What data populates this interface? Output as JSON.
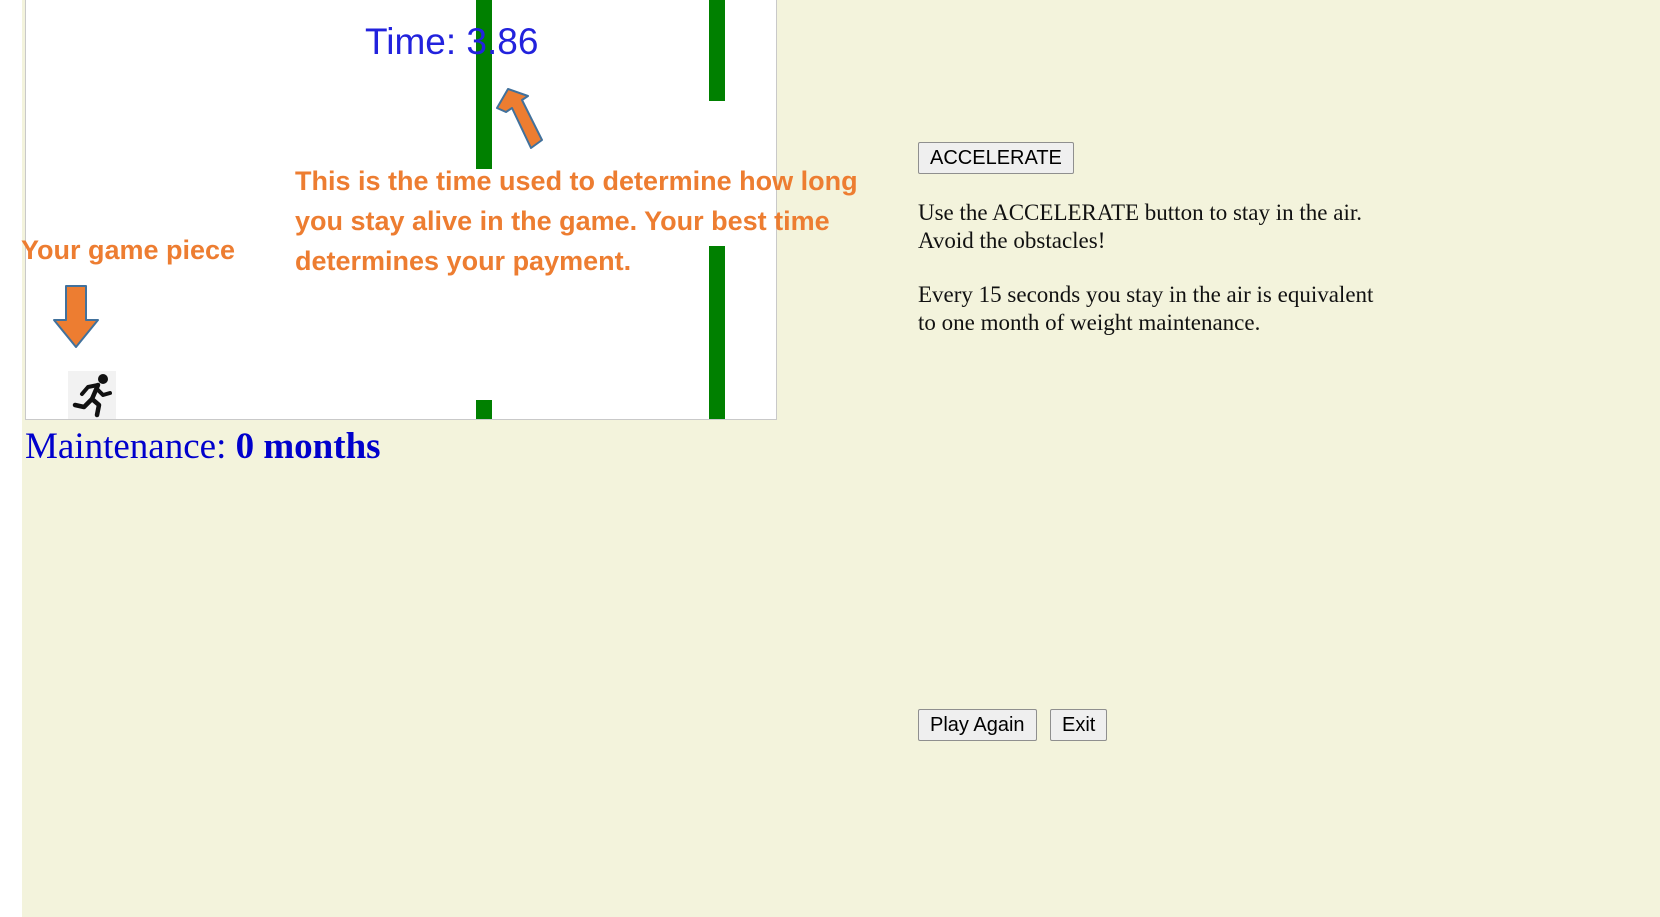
{
  "game": {
    "timer_label": "Time: ",
    "timer_value": "3.86",
    "pipe_color": "#008000",
    "game_piece_icon": "running-person-icon"
  },
  "status": {
    "maintenance_label": "Maintenance: ",
    "maintenance_value": "0 months"
  },
  "annotations": {
    "game_piece": "Your game piece",
    "time_explanation": "This is the time used to determine how long you stay alive in the game.  Your best time determines your payment.",
    "color": "#ed7d31"
  },
  "controls": {
    "accelerate_label": "ACCELERATE",
    "play_again_label": "Play Again",
    "exit_label": "Exit"
  },
  "instructions": {
    "line1": "Use the ACCELERATE button to stay in the air. Avoid the obstacles!",
    "line2": "Every 15 seconds you stay in the air is equivalent to one month of weight maintenance."
  },
  "colors": {
    "page_background": "#f3f3dc",
    "timer_text": "#2222dd",
    "maintenance_text": "#0000cc"
  }
}
